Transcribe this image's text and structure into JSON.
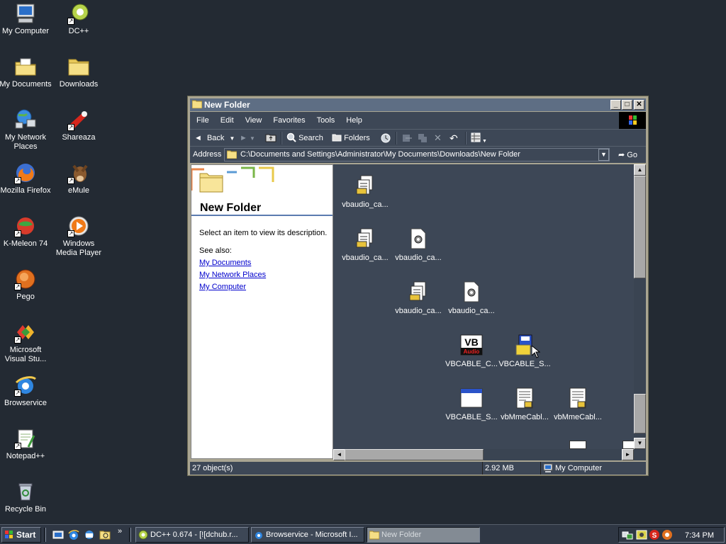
{
  "desktop": {
    "icons": [
      {
        "label": "My Computer",
        "icon": "my-computer-icon",
        "shortcut": false
      },
      {
        "label": "DC++",
        "icon": "dcpp-icon",
        "shortcut": true
      },
      {
        "label": "My Documents",
        "icon": "my-documents-icon",
        "shortcut": false
      },
      {
        "label": "Downloads",
        "icon": "folder-icon",
        "shortcut": false
      },
      {
        "label": "My Network Places",
        "icon": "network-places-icon",
        "shortcut": false
      },
      {
        "label": "Shareaza",
        "icon": "shareaza-icon",
        "shortcut": true
      },
      {
        "label": "Mozilla Firefox",
        "icon": "firefox-icon",
        "shortcut": true
      },
      {
        "label": "eMule",
        "icon": "emule-icon",
        "shortcut": true
      },
      {
        "label": "K-Meleon 74",
        "icon": "kmeleon-icon",
        "shortcut": true
      },
      {
        "label": "Windows Media Player",
        "icon": "media-player-icon",
        "shortcut": true
      },
      {
        "label": "Pego",
        "icon": "pego-icon",
        "shortcut": true
      },
      {
        "label": "Microsoft Visual Stu...",
        "icon": "visual-studio-icon",
        "shortcut": true
      },
      {
        "label": "Browservice",
        "icon": "internet-explorer-icon",
        "shortcut": true
      },
      {
        "label": "Notepad++",
        "icon": "notepadpp-icon",
        "shortcut": true
      },
      {
        "label": "Recycle Bin",
        "icon": "recycle-bin-icon",
        "shortcut": false
      }
    ]
  },
  "window": {
    "title": "New Folder",
    "controls": {
      "minimize": "_",
      "maximize": "□",
      "close": "✕"
    },
    "menu": [
      "File",
      "Edit",
      "View",
      "Favorites",
      "Tools",
      "Help"
    ],
    "toolbar": {
      "back": "Back",
      "search": "Search",
      "folders": "Folders"
    },
    "address": {
      "label": "Address",
      "value": "C:\\Documents and Settings\\Administrator\\My Documents\\Downloads\\New Folder",
      "go": "Go"
    },
    "left_pane": {
      "title": "New Folder",
      "description": "Select an item to view its description.",
      "see_also": "See also:",
      "links": [
        "My Documents",
        "My Network Places",
        "My Computer"
      ]
    },
    "files": [
      {
        "name": "vbaudio_ca...",
        "icon": "installer-icon"
      },
      {
        "name": "vbaudio_ca...",
        "icon": "installer-icon"
      },
      {
        "name": "vbaudio_ca...",
        "icon": "settings-file-icon"
      },
      {
        "name": "vbaudio_ca...",
        "icon": "installer-icon"
      },
      {
        "name": "vbaudio_ca...",
        "icon": "settings-file-icon"
      },
      {
        "name": "VBCABLE_C...",
        "icon": "vb-audio-icon"
      },
      {
        "name": "VBCABLE_S...",
        "icon": "setup-icon"
      },
      {
        "name": "VBCABLE_S...",
        "icon": "window-app-icon"
      },
      {
        "name": "vbMmeCabl...",
        "icon": "notepad-file-icon"
      },
      {
        "name": "vbMmeCabl...",
        "icon": "notepad-file-icon"
      }
    ],
    "status": {
      "objects": "27 object(s)",
      "size": "2.92 MB",
      "zone": "My Computer"
    }
  },
  "taskbar": {
    "start": "Start",
    "tasks": [
      {
        "label": "DC++ 0.674 - [![dchub.r...",
        "active": false
      },
      {
        "label": "Browservice - Microsoft I...",
        "active": false
      },
      {
        "label": "New Folder",
        "active": true
      }
    ],
    "clock": "7:34 PM"
  },
  "colors": {
    "desktop": "#232a33",
    "window_chrome": "#3d4756",
    "titlebar": "#5e6e84",
    "link": "#0000cc"
  }
}
